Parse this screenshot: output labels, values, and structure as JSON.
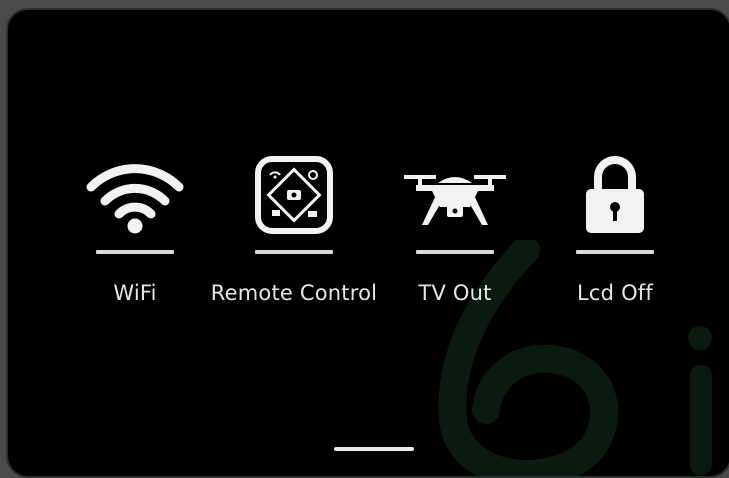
{
  "menu": {
    "items": [
      {
        "label": "WiFi",
        "icon": "wifi-icon"
      },
      {
        "label": "Remote Control",
        "icon": "remote-control-icon"
      },
      {
        "label": "TV Out",
        "icon": "drone-icon"
      },
      {
        "label": "Lcd Off",
        "icon": "lock-icon"
      }
    ]
  },
  "colors": {
    "background": "#000000",
    "foreground": "#e6e6e6",
    "watermark": "#0c1a12"
  }
}
